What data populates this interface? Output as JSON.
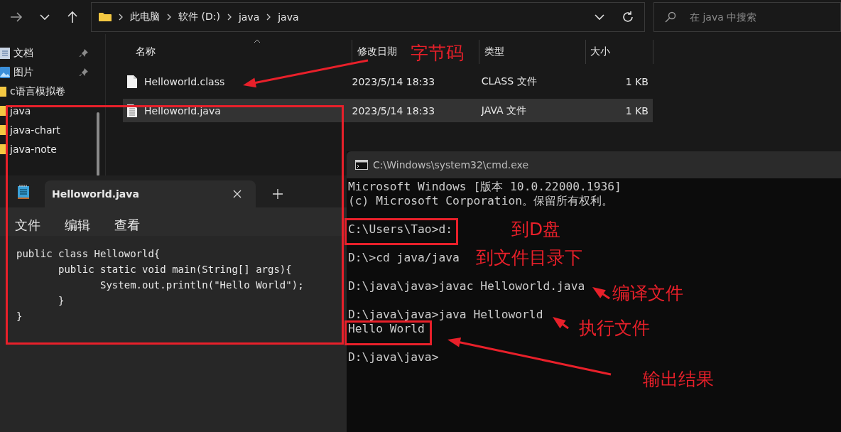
{
  "explorer": {
    "breadcrumbs": [
      "此电脑",
      "软件 (D:)",
      "java",
      "java"
    ],
    "search": {
      "placeholder": "在 java 中搜索"
    },
    "sidebar": [
      {
        "label": "文档",
        "kind": "documents",
        "pinned": true
      },
      {
        "label": "图片",
        "kind": "pictures",
        "pinned": true
      },
      {
        "label": "c语言模拟卷",
        "kind": "folder",
        "pinned": false
      },
      {
        "label": "java",
        "kind": "folder",
        "pinned": false
      },
      {
        "label": "java-chart",
        "kind": "folder",
        "pinned": false
      },
      {
        "label": "java-note",
        "kind": "folder",
        "pinned": false
      }
    ],
    "columns": [
      "名称",
      "修改日期",
      "类型",
      "大小"
    ],
    "rows": [
      {
        "name": "Helloworld.class",
        "date": "2023/5/14 18:33",
        "type": "CLASS 文件",
        "size": "1 KB",
        "kind": "blank",
        "selected": false
      },
      {
        "name": "Helloworld.java",
        "date": "2023/5/14 18:33",
        "type": "JAVA 文件",
        "size": "1 KB",
        "kind": "text",
        "selected": true
      }
    ]
  },
  "notepad": {
    "tab_title": "Helloworld.java",
    "menu": [
      "文件",
      "编辑",
      "查看"
    ],
    "code": [
      "public class Helloworld{",
      "       public static void main(String[] args){",
      "              System.out.println(\"Hello World\");",
      "       }",
      "}"
    ]
  },
  "cmd": {
    "title": "C:\\Windows\\system32\\cmd.exe",
    "blocks": [
      [
        "Microsoft Windows [版本 10.0.22000.1936]",
        "(c) Microsoft Corporation。保留所有权利。"
      ],
      [
        "C:\\Users\\Tao>d:"
      ],
      [
        "D:\\>cd java/java"
      ],
      [
        "D:\\java\\java>javac Helloworld.java"
      ],
      [
        "D:\\java\\java>java Helloworld",
        "Hello World"
      ],
      [
        "D:\\java\\java>"
      ]
    ]
  },
  "annotations": [
    "字节码",
    "到D盘",
    "到文件目录下",
    "编译文件",
    "执行文件",
    "输出结果"
  ]
}
